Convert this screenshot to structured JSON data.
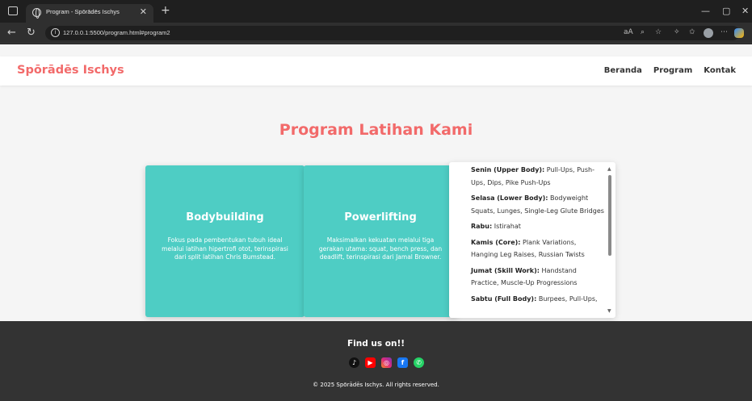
{
  "browser": {
    "tab_title": "Program - Spōrādēs Ischys",
    "url": "127.0.0.1:5500/program.html#program2"
  },
  "navbar": {
    "brand": "Spōrādēs Ischys",
    "links": [
      "Beranda",
      "Program",
      "Kontak"
    ]
  },
  "main": {
    "heading": "Program Latihan Kami",
    "cards": [
      {
        "title": "Bodybuilding",
        "desc": "Fokus pada pembentukan tubuh ideal melalui latihan hipertrofi otot, terinspirasi dari split latihan Chris Bumstead."
      },
      {
        "title": "Powerlifting",
        "desc": "Maksimalkan kekuatan melalui tiga gerakan utama: squat, bench press, dan deadlift, terinspirasi dari Jamal Browner."
      }
    ],
    "schedule": [
      {
        "day": "Senin (Upper Body):",
        "text": " Pull-Ups, Push-Ups, Dips, Pike Push-Ups"
      },
      {
        "day": "Selasa (Lower Body):",
        "text": " Bodyweight Squats, Lunges, Single-Leg Glute Bridges"
      },
      {
        "day": "Rabu:",
        "text": " Istirahat"
      },
      {
        "day": "Kamis (Core):",
        "text": " Plank Variations, Hanging Leg Raises, Russian Twists"
      },
      {
        "day": "Jumat (Skill Work):",
        "text": " Handstand Practice, Muscle-Up Progressions"
      },
      {
        "day": "Sabtu (Full Body):",
        "text": " Burpees, Pull-Ups,"
      }
    ]
  },
  "footer": {
    "find_us": "Find us on!!",
    "socials": [
      "tiktok-icon",
      "youtube-icon",
      "instagram-icon",
      "facebook-icon",
      "whatsapp-icon"
    ],
    "copyright": "© 2025 Spōrādēs Ischys. All rights reserved."
  },
  "colors": {
    "accent": "#f26a6a",
    "card": "#4ecdc4",
    "footer": "#333333"
  }
}
